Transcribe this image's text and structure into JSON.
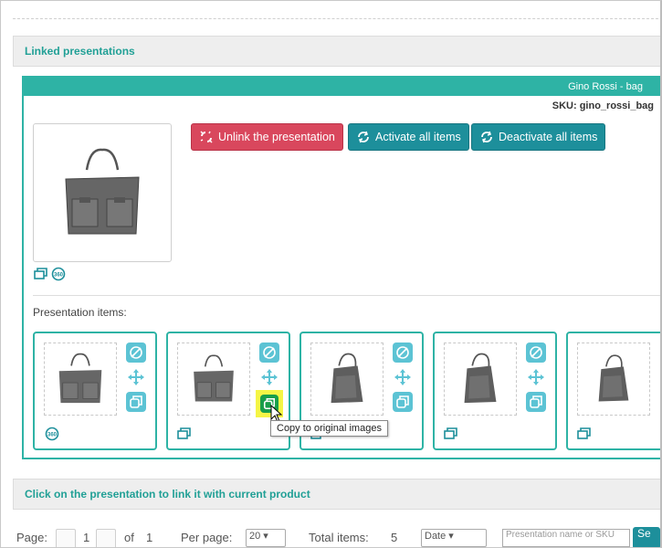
{
  "sections": {
    "linked_title": "Linked presentations",
    "click_title": "Click on the presentation to link it with current product"
  },
  "presentation": {
    "header": "Gino Rossi - bag",
    "sku_label": "SKU:",
    "sku_value": "gino_rossi_bag",
    "buttons": {
      "unlink": "Unlink the presentation",
      "activate": "Activate all items",
      "deactivate": "Deactivate all items"
    },
    "items_label": "Presentation items:"
  },
  "tooltip": "Copy to original images",
  "pager": {
    "page_label": "Page:",
    "page_value": "1",
    "of_label": "of",
    "of_value": "1",
    "per_page_label": "Per page:",
    "per_page_value": "20",
    "total_label": "Total items:",
    "total_value": "5",
    "sort_value": "Date",
    "search_placeholder": "Presentation name or SKU",
    "search_button": "Se"
  },
  "colors": {
    "accent": "#2eb3a5",
    "danger": "#d9475d",
    "teal_button": "#1d8f9b",
    "icon": "#5cc3d4",
    "highlight": "#f5f545",
    "copy_active": "#189e4a"
  }
}
